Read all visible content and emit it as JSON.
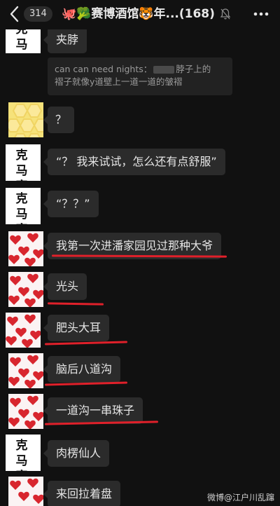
{
  "header": {
    "unread_count": "314",
    "title": "🐙🥦赛博酒馆🐯年...",
    "member_count": "(168)"
  },
  "avatars": {
    "ma_sai_top": "克 马塞",
    "ma_sai_bottom": "马塞"
  },
  "messages": [
    {
      "text": "夹脖"
    },
    {
      "text": "？"
    },
    {
      "text": "“？ 我来试试，怎么还有点舒服”"
    },
    {
      "text": "“？？”"
    },
    {
      "text": "我第一次进潘家园见过那种大爷"
    },
    {
      "text": "光头"
    },
    {
      "text": "肥头大耳"
    },
    {
      "text": "脑后八道沟"
    },
    {
      "text": "一道沟一串珠子"
    },
    {
      "text": "肉楞仙人"
    },
    {
      "text": "来回拉着盘"
    }
  ],
  "quote": {
    "line1_before": "can can need nights：",
    "line1_after": "脖子上的",
    "line2": "褶子就像y道壁上一道一道的皱褶"
  },
  "watermark": "微博@江户川乱蹿",
  "colors": {
    "background": "#111111",
    "bubble": "#2b2b2b",
    "underline": "#e0202a"
  }
}
